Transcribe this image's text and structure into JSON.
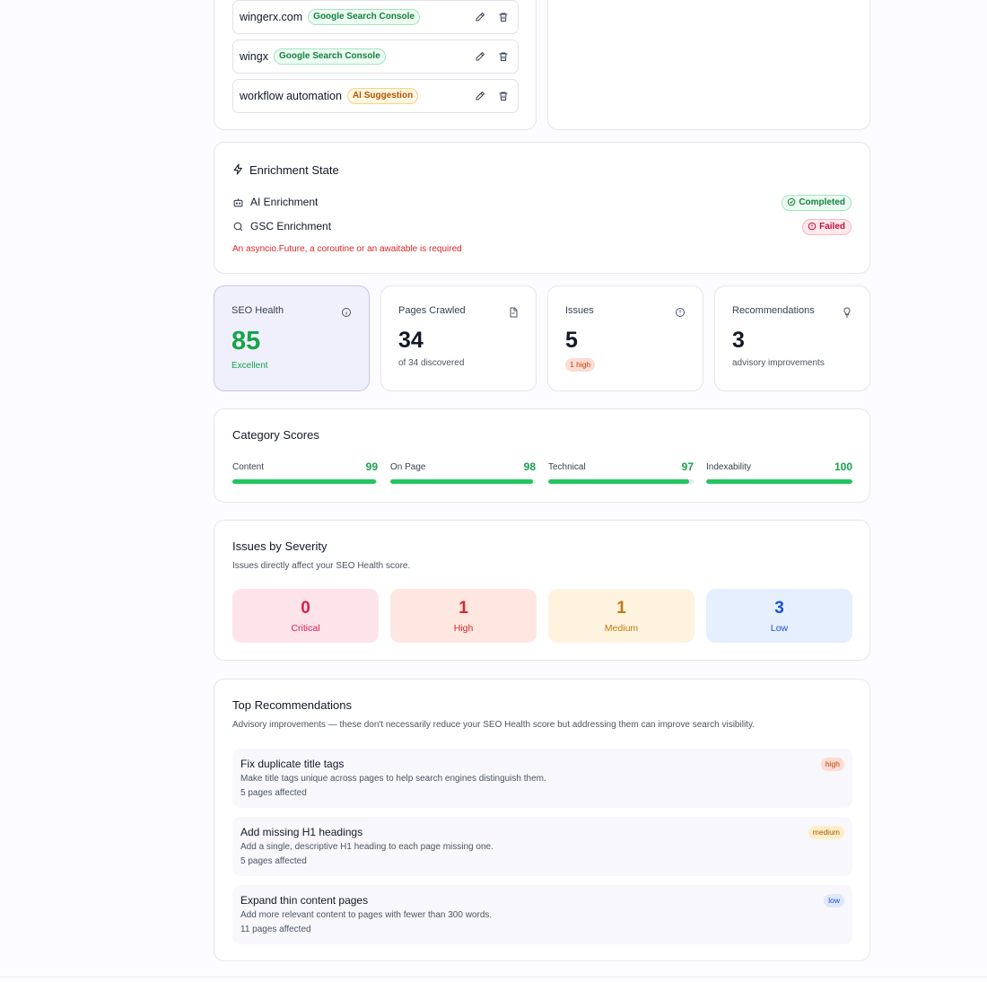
{
  "keywords": [
    {
      "text": "wingerx.com",
      "source": "Google Search Console",
      "type": "gsc"
    },
    {
      "text": "wingx",
      "source": "Google Search Console",
      "type": "gsc"
    },
    {
      "text": "workflow automation",
      "source": "AI Suggestion",
      "type": "ai"
    }
  ],
  "enrichment": {
    "title": "Enrichment State",
    "ai": {
      "label": "AI Enrichment",
      "status": "Completed"
    },
    "gsc": {
      "label": "GSC Enrichment",
      "status": "Failed"
    },
    "error": "An asyncio.Future, a coroutine or an awaitable is required"
  },
  "stats": {
    "seo": {
      "label": "SEO Health",
      "value": "85",
      "sub": "Excellent"
    },
    "pages": {
      "label": "Pages Crawled",
      "value": "34",
      "sub": "of 34 discovered"
    },
    "issues": {
      "label": "Issues",
      "value": "5",
      "badge": "1 high"
    },
    "recs": {
      "label": "Recommendations",
      "value": "3",
      "sub": "advisory improvements"
    }
  },
  "categories": {
    "title": "Category Scores",
    "items": [
      {
        "name": "Content",
        "score": 99
      },
      {
        "name": "On Page",
        "score": 98
      },
      {
        "name": "Technical",
        "score": 97
      },
      {
        "name": "Indexability",
        "score": 100
      }
    ]
  },
  "severity": {
    "title": "Issues by Severity",
    "desc": "Issues directly affect your SEO Health score.",
    "items": [
      {
        "count": "0",
        "label": "Critical"
      },
      {
        "count": "1",
        "label": "High"
      },
      {
        "count": "1",
        "label": "Medium"
      },
      {
        "count": "3",
        "label": "Low"
      }
    ]
  },
  "recommendations": {
    "title": "Top Recommendations",
    "desc": "Advisory improvements — these don't necessarily reduce your SEO Health score but addressing them can improve search visibility.",
    "items": [
      {
        "title": "Fix duplicate title tags",
        "desc": "Make title tags unique across pages to help search engines distinguish them.",
        "pages": "5 pages affected",
        "priority": "high"
      },
      {
        "title": "Add missing H1 headings",
        "desc": "Add a single, descriptive H1 heading to each page missing one.",
        "pages": "5 pages affected",
        "priority": "medium"
      },
      {
        "title": "Expand thin content pages",
        "desc": "Add more relevant content to pages with fewer than 300 words.",
        "pages": "11 pages affected",
        "priority": "low"
      }
    ]
  },
  "colors": {
    "green": "#16a34a",
    "critical": "#e11d48",
    "high": "#dc2626",
    "medium": "#c2790f",
    "low": "#1d4ed8"
  }
}
